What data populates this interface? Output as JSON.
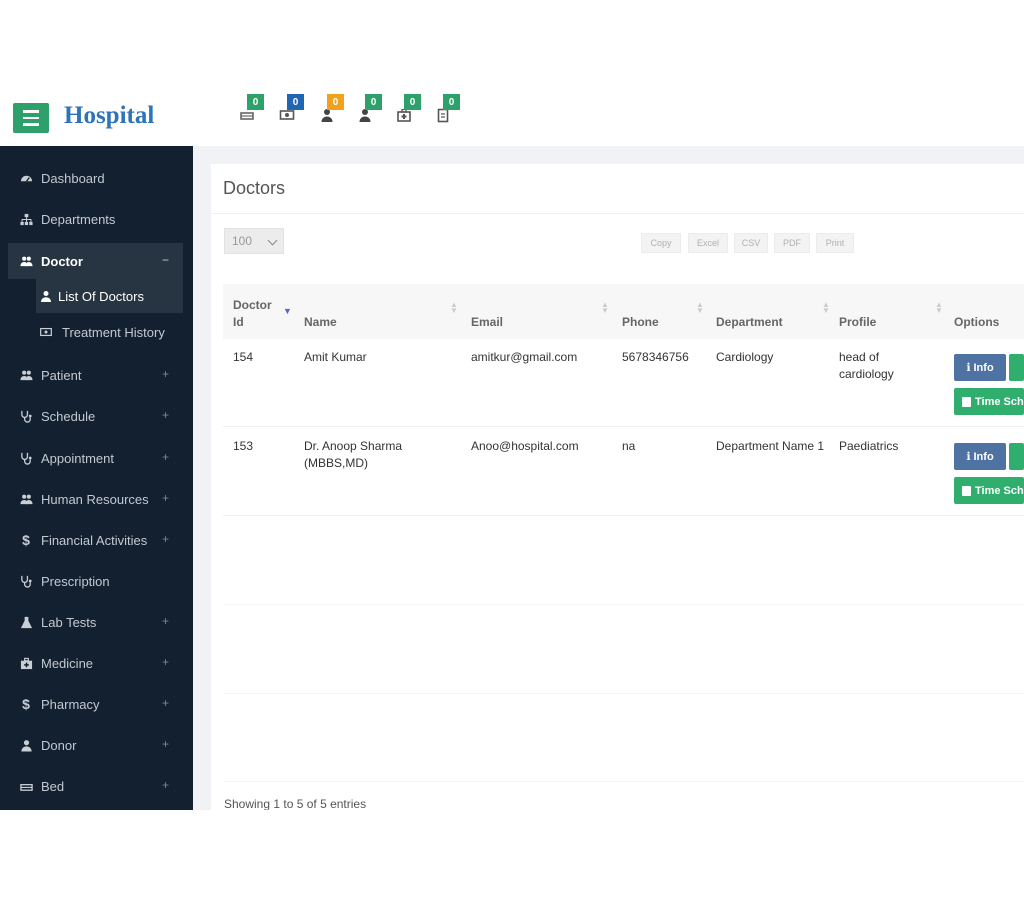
{
  "app": {
    "brand": "Hospital"
  },
  "notifications": [
    {
      "icon": "hospital-bed-icon",
      "count": "0",
      "color": "#2ea06a"
    },
    {
      "icon": "money-icon",
      "count": "0",
      "color": "#2166b3"
    },
    {
      "icon": "user-icon",
      "count": "0",
      "color": "#f0a21c"
    },
    {
      "icon": "user-icon",
      "count": "0",
      "color": "#2ea06a"
    },
    {
      "icon": "medkit-icon",
      "count": "0",
      "color": "#2ea06a"
    },
    {
      "icon": "clipboard-icon",
      "count": "0",
      "color": "#2ea06a"
    }
  ],
  "sidebar": {
    "items": [
      {
        "label": "Dashboard",
        "icon": "dashboard-icon",
        "expandable": false
      },
      {
        "label": "Departments",
        "icon": "sitemap-icon",
        "expandable": false
      },
      {
        "label": "Doctor",
        "icon": "users-icon",
        "expandable": true,
        "expanded": true,
        "toggle": "−"
      },
      {
        "label": "Patient",
        "icon": "users-icon",
        "expandable": true,
        "toggle": "+"
      },
      {
        "label": "Schedule",
        "icon": "stethoscope-icon",
        "expandable": true,
        "toggle": "+"
      },
      {
        "label": "Appointment",
        "icon": "stethoscope-icon",
        "expandable": true,
        "toggle": "+"
      },
      {
        "label": "Human Resources",
        "icon": "users-icon",
        "expandable": true,
        "toggle": "+"
      },
      {
        "label": "Financial Activities",
        "icon": "dollar-icon",
        "expandable": true,
        "toggle": "+"
      },
      {
        "label": "Prescription",
        "icon": "stethoscope-icon",
        "expandable": false
      },
      {
        "label": "Lab Tests",
        "icon": "flask-icon",
        "expandable": true,
        "toggle": "+"
      },
      {
        "label": "Medicine",
        "icon": "medkit-icon",
        "expandable": true,
        "toggle": "+"
      },
      {
        "label": "Pharmacy",
        "icon": "dollar-icon",
        "expandable": true,
        "toggle": "+"
      },
      {
        "label": "Donor",
        "icon": "user-icon",
        "expandable": true,
        "toggle": "+"
      },
      {
        "label": "Bed",
        "icon": "hospital-bed-icon",
        "expandable": true,
        "toggle": "+"
      }
    ],
    "doctor_submenu": [
      {
        "label": "List Of Doctors",
        "icon": "user-icon",
        "active": true
      },
      {
        "label": "Treatment History",
        "icon": "money-icon",
        "active": false
      }
    ]
  },
  "main": {
    "title": "Doctors",
    "page_length": "100",
    "export_buttons": [
      "Copy",
      "Excel",
      "CSV",
      "PDF",
      "Print"
    ],
    "columns": [
      "Doctor Id",
      "Name",
      "Email",
      "Phone",
      "Department",
      "Profile",
      "Options"
    ],
    "rows": [
      {
        "id": "154",
        "name": "Amit Kumar",
        "email": "amitkur@gmail.com",
        "phone": "5678346756",
        "department": "Cardiology",
        "profile": "head of cardiology"
      },
      {
        "id": "153",
        "name": "Dr. Anoop Sharma (MBBS,MD)",
        "email": "Anoo@hospital.com",
        "phone": "na",
        "department": "Department Name 1",
        "profile": "Paediatrics"
      }
    ],
    "row_actions": {
      "info": "Info",
      "schedule": "Time Sch"
    },
    "footer_info": "Showing 1 to 5 of 5 entries"
  }
}
